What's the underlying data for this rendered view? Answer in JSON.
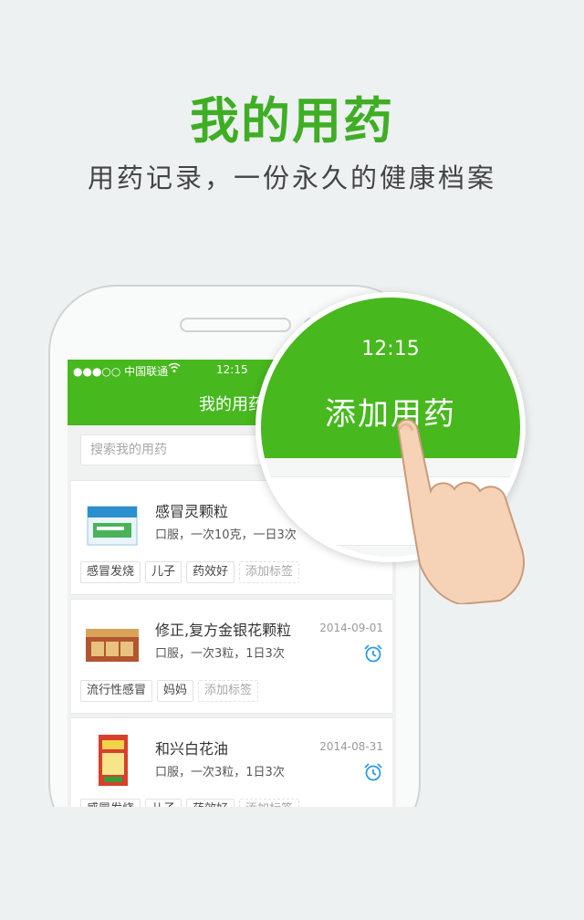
{
  "hero": {
    "title": "我的用药",
    "subtitle": "用药记录，一份永久的健康档案"
  },
  "status_bar": {
    "carrier": "●●●○○ 中国联通",
    "time": "12:15"
  },
  "nav": {
    "title": "我的用药"
  },
  "search": {
    "placeholder": "搜索我的用药"
  },
  "medications": [
    {
      "name": "感冒灵颗粒",
      "date": "",
      "dose": "口服，一次10克，一日3次",
      "tags": [
        "感冒发烧",
        "儿子",
        "药效好"
      ],
      "add_tag": "添加标签"
    },
    {
      "name": "修正,复方金银花颗粒",
      "date": "2014-09-01",
      "dose": "口服，一次3粒，1日3次",
      "tags": [
        "流行性感冒",
        "妈妈"
      ],
      "add_tag": "添加标签"
    },
    {
      "name": "和兴白花油",
      "date": "2014-08-31",
      "dose": "口服，一次3粒，1日3次",
      "tags": [
        "感冒发烧",
        "儿子",
        "药效好"
      ],
      "add_tag": "添加标签"
    }
  ],
  "magnifier": {
    "time": "12:15",
    "title": "添加用药"
  },
  "colors": {
    "brand_green": "#47b81d",
    "headline_green": "#3fae24",
    "alarm_blue": "#2e9be6"
  }
}
